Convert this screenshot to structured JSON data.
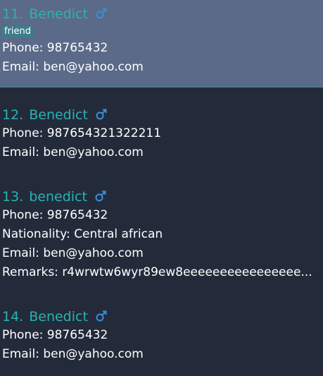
{
  "persons": [
    {
      "index": "11.",
      "name": "Benedict",
      "gender_icon": "male-icon",
      "tags": [
        "friend"
      ],
      "selected": true,
      "fields": [
        {
          "label": "Phone:",
          "value": "98765432"
        },
        {
          "label": "Email:",
          "value": "ben@yahoo.com"
        }
      ]
    },
    {
      "index": "12.",
      "name": "Benedict",
      "gender_icon": "male-icon",
      "tags": [],
      "selected": false,
      "fields": [
        {
          "label": "Phone:",
          "value": "987654321322211"
        },
        {
          "label": "Email:",
          "value": "ben@yahoo.com"
        }
      ]
    },
    {
      "index": "13.",
      "name": "benedict",
      "gender_icon": "male-icon",
      "tags": [],
      "selected": false,
      "fields": [
        {
          "label": "Phone:",
          "value": "98765432"
        },
        {
          "label": "Nationality:",
          "value": "Central african"
        },
        {
          "label": "Email:",
          "value": "ben@yahoo.com"
        },
        {
          "label": "Remarks:",
          "value": "r4wrwtw6wyr89ew8eeeeeeeeeeeeeeee..."
        }
      ]
    },
    {
      "index": "14.",
      "name": "Benedict",
      "gender_icon": "male-icon",
      "tags": [],
      "selected": false,
      "fields": [
        {
          "label": "Phone:",
          "value": "98765432"
        },
        {
          "label": "Email:",
          "value": "ben@yahoo.com"
        }
      ]
    }
  ],
  "colors": {
    "background": "#232b3b",
    "selected_background": "#5b6a88",
    "name": "#2ab2b0",
    "gender_icon": "#3a8fd6",
    "tag_background": "#3d7c8a",
    "text": "#ffffff"
  }
}
